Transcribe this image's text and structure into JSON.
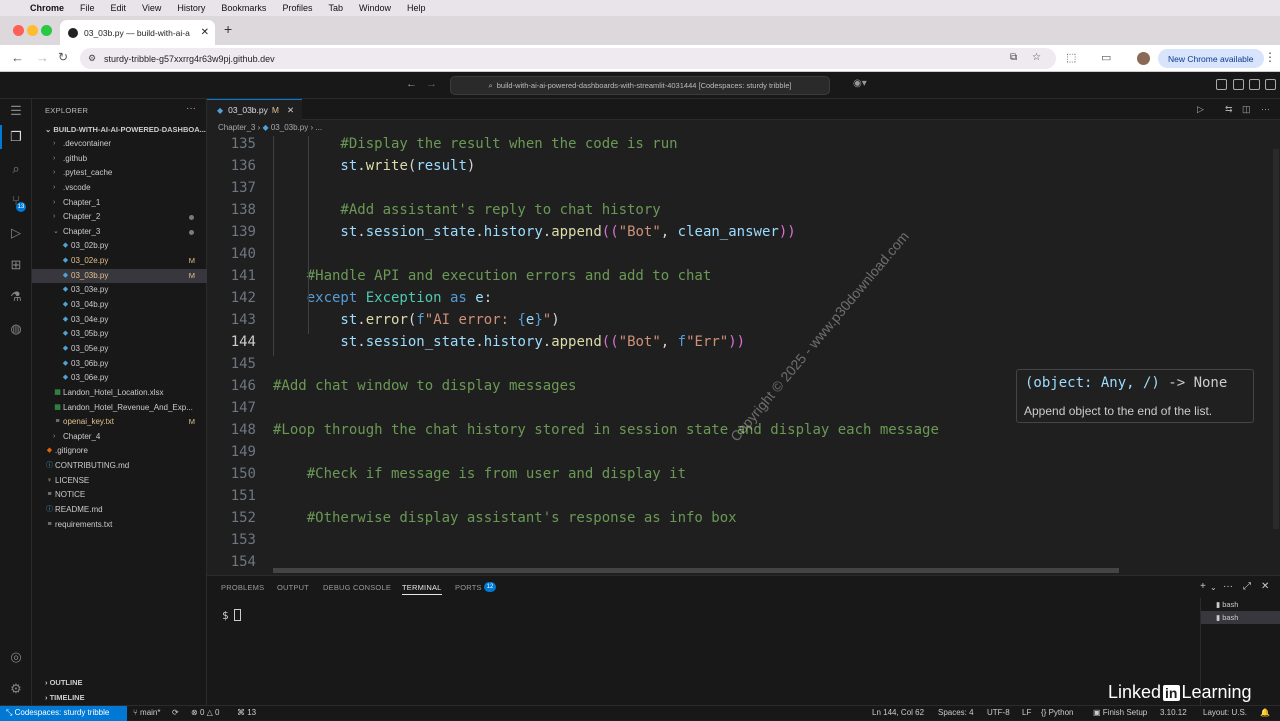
{
  "menubar": {
    "app": "Chrome",
    "items": [
      "File",
      "Edit",
      "View",
      "History",
      "Bookmarks",
      "Profiles",
      "Tab",
      "Window",
      "Help"
    ]
  },
  "browser": {
    "tab_title": "03_03b.py — build-with-ai-a",
    "url": "sturdy-tribble-g57xxrrg4r63w9pj.github.dev",
    "new_chrome": "New Chrome available"
  },
  "vscode": {
    "command_center": "build-with-ai-ai-powered-dashboards-with-streamlit-4031444 [Codespaces: sturdy tribble]",
    "explorer_title": "EXPLORER",
    "project": "BUILD-WITH-AI-AI-POWERED-DASHBOA...",
    "activity_badge": "13",
    "tree": [
      {
        "name": ".devcontainer",
        "type": "folder",
        "open": false,
        "depth": 1,
        "status": ""
      },
      {
        "name": ".github",
        "type": "folder",
        "open": false,
        "depth": 1,
        "status": ""
      },
      {
        "name": ".pytest_cache",
        "type": "folder",
        "open": false,
        "depth": 1,
        "status": ""
      },
      {
        "name": ".vscode",
        "type": "folder",
        "open": false,
        "depth": 1,
        "status": ""
      },
      {
        "name": "Chapter_1",
        "type": "folder",
        "open": false,
        "depth": 1,
        "status": ""
      },
      {
        "name": "Chapter_2",
        "type": "folder",
        "open": false,
        "depth": 1,
        "status": "dot"
      },
      {
        "name": "Chapter_3",
        "type": "folder",
        "open": true,
        "depth": 1,
        "status": "dot"
      },
      {
        "name": "03_02b.py",
        "type": "py",
        "depth": 2,
        "status": ""
      },
      {
        "name": "03_02e.py",
        "type": "py",
        "depth": 2,
        "status": "M"
      },
      {
        "name": "03_03b.py",
        "type": "py",
        "depth": 2,
        "status": "M",
        "selected": true
      },
      {
        "name": "03_03e.py",
        "type": "py",
        "depth": 2,
        "status": ""
      },
      {
        "name": "03_04b.py",
        "type": "py",
        "depth": 2,
        "status": ""
      },
      {
        "name": "03_04e.py",
        "type": "py",
        "depth": 2,
        "status": ""
      },
      {
        "name": "03_05b.py",
        "type": "py",
        "depth": 2,
        "status": ""
      },
      {
        "name": "03_05e.py",
        "type": "py",
        "depth": 2,
        "status": ""
      },
      {
        "name": "03_06b.py",
        "type": "py",
        "depth": 2,
        "status": ""
      },
      {
        "name": "03_06e.py",
        "type": "py",
        "depth": 2,
        "status": ""
      },
      {
        "name": "Landon_Hotel_Location.xlsx",
        "type": "xlsx",
        "depth": 1,
        "status": ""
      },
      {
        "name": "Landon_Hotel_Revenue_And_Exp...",
        "type": "xlsx",
        "depth": 1,
        "status": ""
      },
      {
        "name": "openai_key.txt",
        "type": "txt",
        "depth": 1,
        "status": "M"
      },
      {
        "name": "Chapter_4",
        "type": "folder",
        "open": false,
        "depth": 1,
        "status": ""
      },
      {
        "name": ".gitignore",
        "type": "git",
        "depth": 0,
        "status": ""
      },
      {
        "name": "CONTRIBUTING.md",
        "type": "md",
        "depth": 0,
        "status": ""
      },
      {
        "name": "LICENSE",
        "type": "lic",
        "depth": 0,
        "status": ""
      },
      {
        "name": "NOTICE",
        "type": "txt",
        "depth": 0,
        "status": ""
      },
      {
        "name": "README.md",
        "type": "md",
        "depth": 0,
        "status": ""
      },
      {
        "name": "requirements.txt",
        "type": "txt",
        "depth": 0,
        "status": ""
      }
    ],
    "outline": "OUTLINE",
    "timeline": "TIMELINE",
    "editor_tab": {
      "name": "03_03b.py",
      "status": "M"
    },
    "breadcrumb": [
      "Chapter_3",
      "03_03b.py",
      "..."
    ],
    "current_line": "144",
    "code_lines": [
      {
        "n": "135",
        "t": [
          [
            "cm",
            "        #Display the result when the code is run"
          ]
        ]
      },
      {
        "n": "136",
        "t": [
          [
            "var",
            "        st"
          ],
          [
            "pu",
            "."
          ],
          [
            "fn",
            "write"
          ],
          [
            "pu",
            "("
          ],
          [
            "var",
            "result"
          ],
          [
            "pu",
            ")"
          ]
        ]
      },
      {
        "n": "137",
        "t": []
      },
      {
        "n": "138",
        "t": [
          [
            "cm",
            "        #Add assistant's reply to chat history"
          ]
        ]
      },
      {
        "n": "139",
        "t": [
          [
            "var",
            "        st"
          ],
          [
            "pu",
            "."
          ],
          [
            "var",
            "session_state"
          ],
          [
            "pu",
            "."
          ],
          [
            "var",
            "history"
          ],
          [
            "pu",
            "."
          ],
          [
            "fn",
            "append"
          ],
          [
            "br",
            "(("
          ],
          [
            "str",
            "\"Bot\""
          ],
          [
            "pu",
            ", "
          ],
          [
            "var",
            "clean_answer"
          ],
          [
            "br",
            "))"
          ]
        ]
      },
      {
        "n": "140",
        "t": []
      },
      {
        "n": "141",
        "t": [
          [
            "cm",
            "    #Handle API and execution errors and add to chat"
          ]
        ]
      },
      {
        "n": "142",
        "t": [
          [
            "kw",
            "    except "
          ],
          [
            "cls",
            "Exception"
          ],
          [
            "kw",
            " as "
          ],
          [
            "var",
            "e"
          ],
          [
            "pu",
            ":"
          ]
        ]
      },
      {
        "n": "143",
        "t": [
          [
            "var",
            "        st"
          ],
          [
            "pu",
            "."
          ],
          [
            "fn",
            "error"
          ],
          [
            "pu",
            "("
          ],
          [
            "kw",
            "f"
          ],
          [
            "str",
            "\"AI error: "
          ],
          [
            "kw",
            "{"
          ],
          [
            "var",
            "e"
          ],
          [
            "kw",
            "}"
          ],
          [
            "str",
            "\""
          ],
          [
            "pu",
            ")"
          ]
        ]
      },
      {
        "n": "144",
        "t": [
          [
            "var",
            "        st"
          ],
          [
            "pu",
            "."
          ],
          [
            "var",
            "session_state"
          ],
          [
            "pu",
            "."
          ],
          [
            "var",
            "history"
          ],
          [
            "pu",
            "."
          ],
          [
            "fn",
            "append"
          ],
          [
            "br",
            "(("
          ],
          [
            "str",
            "\"Bot\""
          ],
          [
            "pu",
            ", "
          ],
          [
            "kw",
            "f"
          ],
          [
            "str",
            "\"Err\""
          ],
          [
            "br",
            "))"
          ]
        ]
      },
      {
        "n": "145",
        "t": []
      },
      {
        "n": "146",
        "t": [
          [
            "cm",
            "#Add chat window to display messages"
          ]
        ]
      },
      {
        "n": "147",
        "t": []
      },
      {
        "n": "148",
        "t": [
          [
            "cm",
            "#Loop through the chat history stored in session state and display each message"
          ]
        ]
      },
      {
        "n": "149",
        "t": []
      },
      {
        "n": "150",
        "t": [
          [
            "cm",
            "    #Check if message is from user and display it"
          ]
        ]
      },
      {
        "n": "151",
        "t": []
      },
      {
        "n": "152",
        "t": [
          [
            "cm",
            "    #Otherwise display assistant's response as info box"
          ]
        ]
      },
      {
        "n": "153",
        "t": []
      },
      {
        "n": "154",
        "t": []
      }
    ],
    "hover": {
      "signature_param": "(object: Any, /)",
      "signature_ret": " -> None",
      "doc": "Append object to the end of the list."
    },
    "watermark": "Copyright © 2025 - www.p30download.com",
    "panel_tabs": [
      "PROBLEMS",
      "OUTPUT",
      "DEBUG CONSOLE",
      "TERMINAL",
      "PORTS"
    ],
    "ports_badge": "12",
    "prompt": "$",
    "terminals": [
      "bash",
      "bash"
    ],
    "status": {
      "remote": "Codespaces: sturdy tribble",
      "branch": "main*",
      "errors": "0",
      "warnings": "0",
      "ports": "13",
      "position": "Ln 144, Col 62",
      "spaces": "Spaces: 4",
      "encoding": "UTF-8",
      "eol": "LF",
      "language": "Python",
      "finish": "Finish Setup",
      "version": "3.10.12",
      "layout": "Layout: U.S."
    }
  },
  "brand": {
    "left": "Linked",
    "in": "in",
    "right": "Learning"
  },
  "colors": {
    "accent": "#0078d4",
    "comment": "#6a9955",
    "keyword": "#569cd6",
    "string": "#ce9178",
    "function": "#dcdcaa"
  }
}
